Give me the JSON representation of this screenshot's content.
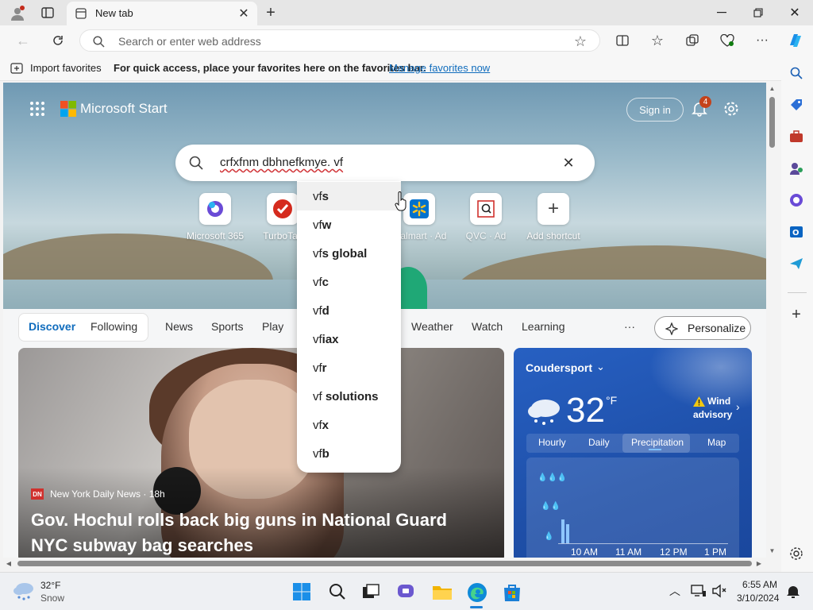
{
  "browser": {
    "tab_title": "New tab",
    "address_placeholder": "Search or enter web address",
    "favorites_import": "Import favorites",
    "favorites_hint": "For quick access, place your favorites here on the favorites bar.",
    "favorites_manage_link": "Manage favorites now"
  },
  "start": {
    "brand": "Microsoft Start",
    "sign_in": "Sign in",
    "notification_count": "4",
    "search_value": "crfxfnm dbhnefkmye. vf",
    "quick_links": [
      {
        "label": "Microsoft 365"
      },
      {
        "label": "TurboTax"
      },
      {
        "label": "Walmart · Ad"
      },
      {
        "label": "QVC · Ad"
      },
      {
        "label": "Add shortcut"
      }
    ],
    "suggestions": [
      {
        "prefix": "vf",
        "rest": "s"
      },
      {
        "prefix": "vf",
        "rest": "w"
      },
      {
        "prefix": "vf",
        "rest": "s global"
      },
      {
        "prefix": "vf",
        "rest": "c"
      },
      {
        "prefix": "vf",
        "rest": "d"
      },
      {
        "prefix": "vf",
        "rest": "iax"
      },
      {
        "prefix": "vf",
        "rest": "r"
      },
      {
        "prefix": "vf",
        "rest": " solutions"
      },
      {
        "prefix": "vf",
        "rest": "x"
      },
      {
        "prefix": "vf",
        "rest": "b"
      }
    ],
    "feed_tabs": {
      "discover": "Discover",
      "following": "Following",
      "news": "News",
      "sports": "Sports",
      "play": "Play",
      "weather": "Weather",
      "watch": "Watch",
      "learning": "Learning",
      "more": "···",
      "personalize": "Personalize"
    },
    "news": {
      "source_badge": "DN",
      "source": "New York Daily News · 18h",
      "headline_line1": "Gov. Hochul rolls back big guns in National Guard",
      "headline_line2": "NYC subway bag searches"
    },
    "weather": {
      "location": "Coudersport",
      "temp": "32",
      "unit": "°F",
      "alert_line1": "Wind",
      "alert_line2": "advisory",
      "tabs": [
        "Hourly",
        "Daily",
        "Precipitation",
        "Map"
      ],
      "times": [
        "10 AM",
        "11 AM",
        "12 PM",
        "1 PM"
      ]
    }
  },
  "taskbar": {
    "weather_temp": "32°F",
    "weather_cond": "Snow",
    "time": "6:55 AM",
    "date": "3/10/2024"
  },
  "colors": {
    "accent": "#0f6cbd",
    "weather_bg": "#2760c2",
    "notif_badge": "#c4421a"
  }
}
